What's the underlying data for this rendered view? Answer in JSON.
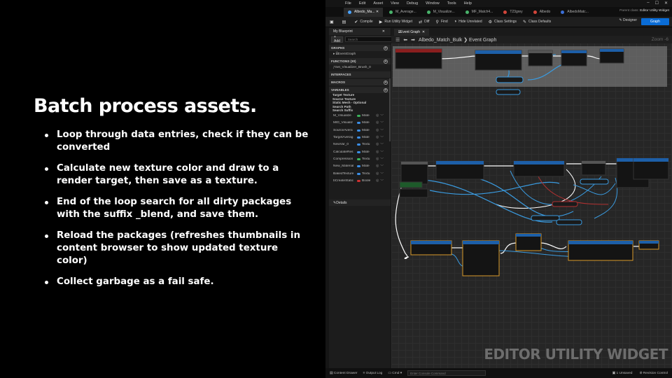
{
  "slide": {
    "title": "Batch process assets.",
    "bullets": [
      "Loop through data entries, check if they can be converted",
      "Calculate new texture color and draw to a render target, then save as a texture.",
      "End of the loop search for all dirty packages with the suffix _blend, and save them.",
      "Reload the packages (refreshes thumbnails in content browser to show updated texture color)",
      "Collect garbage as a fail safe."
    ]
  },
  "editor": {
    "logo": "U",
    "menu": [
      "File",
      "Edit",
      "Asset",
      "View",
      "Debug",
      "Window",
      "Tools",
      "Help"
    ],
    "window_controls": [
      "–",
      "☐",
      "✕"
    ],
    "tabs": [
      {
        "label": "Albedo_Ma...",
        "color": "#4aa3ff",
        "active": true
      },
      {
        "label": "M_Average...",
        "color": "#49b36b",
        "active": false
      },
      {
        "label": "M_Visualize...",
        "color": "#49b36b",
        "active": false
      },
      {
        "label": "MF_Match4...",
        "color": "#49b36b",
        "active": false
      },
      {
        "label": "T23grey",
        "color": "#d2453a",
        "active": false
      },
      {
        "label": "Albedo",
        "color": "#d2453a",
        "active": false
      },
      {
        "label": "AlbedoMatc...",
        "color": "#3b6fd6",
        "active": false
      }
    ],
    "parent_class_label": "Parent class:",
    "parent_class_value": "Editor Utility Widget",
    "toolbar": {
      "compile": "Compile",
      "run": "Run Utility Widget",
      "diff": "Diff",
      "find": "Find",
      "hide": "Hide Unrelated",
      "class_settings": "Class Settings",
      "class_defaults": "Class Defaults",
      "designer": "Designer",
      "graph": "Graph"
    },
    "my_blueprint": {
      "tab": "My Blueprint",
      "add": "+ Add",
      "search_placeholder": "Search",
      "sections": {
        "graphs": "GRAPHS",
        "functions": "FUNCTIONS (30)",
        "interfaces": "INTERFACES",
        "macros": "MACROS",
        "variables": "VARIABLES"
      },
      "graph_items": [
        "EventGraph"
      ],
      "function_items": [
        "Set_Visualizer_Brush_0"
      ],
      "categories": [
        "Target Texture",
        "Source Texture",
        "Static Mesh - Optional",
        "Search Path",
        "Search Suffix"
      ],
      "variables": [
        {
          "name": "M_Visualize",
          "type": "Mate",
          "color": "#3bb35a"
        },
        {
          "name": "MID_Visualiz",
          "type": "Mate",
          "color": "#3b8fe8"
        },
        {
          "name": "SourceAvera",
          "type": "Mate",
          "color": "#3b8fe8"
        },
        {
          "name": "TargetAverag",
          "type": "Mate",
          "color": "#3b8fe8"
        },
        {
          "name": "NewVar_0",
          "type": "Textu",
          "color": "#3b8fe8"
        },
        {
          "name": "CalculateRes",
          "type": "Mate",
          "color": "#3b8fe8"
        },
        {
          "name": "Compression",
          "type": "Textu",
          "color": "#3bb35a"
        },
        {
          "name": "New_Material",
          "type": "Mate",
          "color": "#3b8fe8"
        },
        {
          "name": "BakedTexture",
          "type": "Textu",
          "color": "#3b8fe8"
        },
        {
          "name": "bCreateStatic",
          "type": "Boole",
          "color": "#d03030"
        }
      ],
      "details": "Details"
    },
    "graph": {
      "tab": "Event Graph",
      "breadcrumb": "Albedo_Match_Bulk  ❯  Event Graph",
      "zoom": "Zoom -6",
      "watermark": "EDITOR UTILITY WIDGET"
    },
    "statusbar": {
      "content_drawer": "Content Drawer",
      "output_log": "Output Log",
      "cmd": "Cmd",
      "console_placeholder": "Enter Console Command",
      "unsaved": "1 Unsaved",
      "revision": "Revision Control"
    }
  }
}
